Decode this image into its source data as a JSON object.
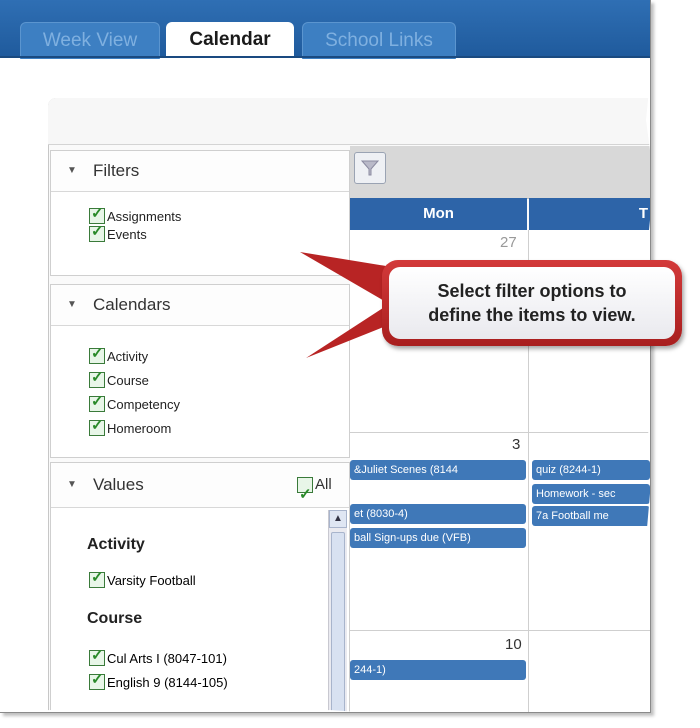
{
  "tabs": [
    {
      "label": "Week View",
      "active": false
    },
    {
      "label": "Calendar",
      "active": true
    },
    {
      "label": "School Links",
      "active": false
    }
  ],
  "sidebar": {
    "filters": {
      "title": "Filters",
      "items": [
        "Assignments",
        "Events"
      ]
    },
    "calendars": {
      "title": "Calendars",
      "items": [
        "Activity",
        "Course",
        "Competency",
        "Homeroom"
      ]
    },
    "values": {
      "title": "Values",
      "all_label": "All",
      "groups": [
        {
          "name": "Activity",
          "items": [
            "Varsity Football"
          ]
        },
        {
          "name": "Course",
          "items": [
            "Cul Arts I (8047-101)",
            "English 9 (8144-105)"
          ]
        }
      ]
    }
  },
  "calendar": {
    "day_headers": [
      "Mon",
      "T"
    ],
    "day_numbers": [
      "27",
      "3",
      "10"
    ],
    "events": {
      "week2_mon": [
        "&Juliet Scenes (8144",
        "et (8030-4)",
        "ball Sign-ups due (VFB)"
      ],
      "week2_tue": [
        "quiz (8244-1)",
        "Homework - sec",
        "7a Football me"
      ],
      "week3_mon": [
        "244-1)"
      ]
    }
  },
  "callout": {
    "line1": "Select filter options to",
    "line2": "define the items to view."
  },
  "colors": {
    "tab_bar": "#2f6fb4",
    "day_header": "#2d64a8",
    "event": "#3f78b8",
    "callout_border": "#c12a2a"
  },
  "icons": {
    "filter": "funnel-icon",
    "collapse": "triangle-down-icon",
    "scroll_up": "chevron-up-icon"
  }
}
